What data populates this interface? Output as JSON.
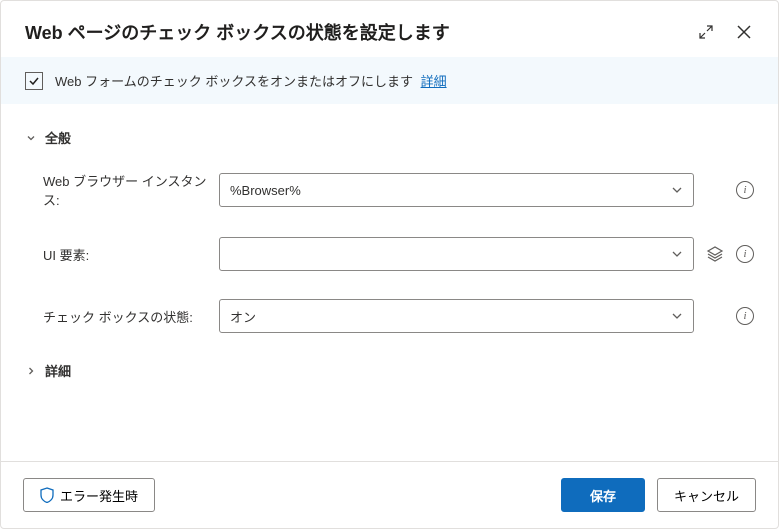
{
  "header": {
    "title": "Web ページのチェック ボックスの状態を設定します"
  },
  "banner": {
    "description": "Web フォームのチェック ボックスをオンまたはオフにします",
    "link_label": "詳細"
  },
  "sections": {
    "general": {
      "label": "全般"
    },
    "advanced": {
      "label": "詳細"
    }
  },
  "fields": {
    "browser_instance": {
      "label": "Web ブラウザー インスタンス:",
      "value": "%Browser%"
    },
    "ui_element": {
      "label": "UI 要素:",
      "value": ""
    },
    "checkbox_state": {
      "label": "チェック ボックスの状態:",
      "value": "オン"
    }
  },
  "footer": {
    "on_error": "エラー発生時",
    "save": "保存",
    "cancel": "キャンセル"
  }
}
